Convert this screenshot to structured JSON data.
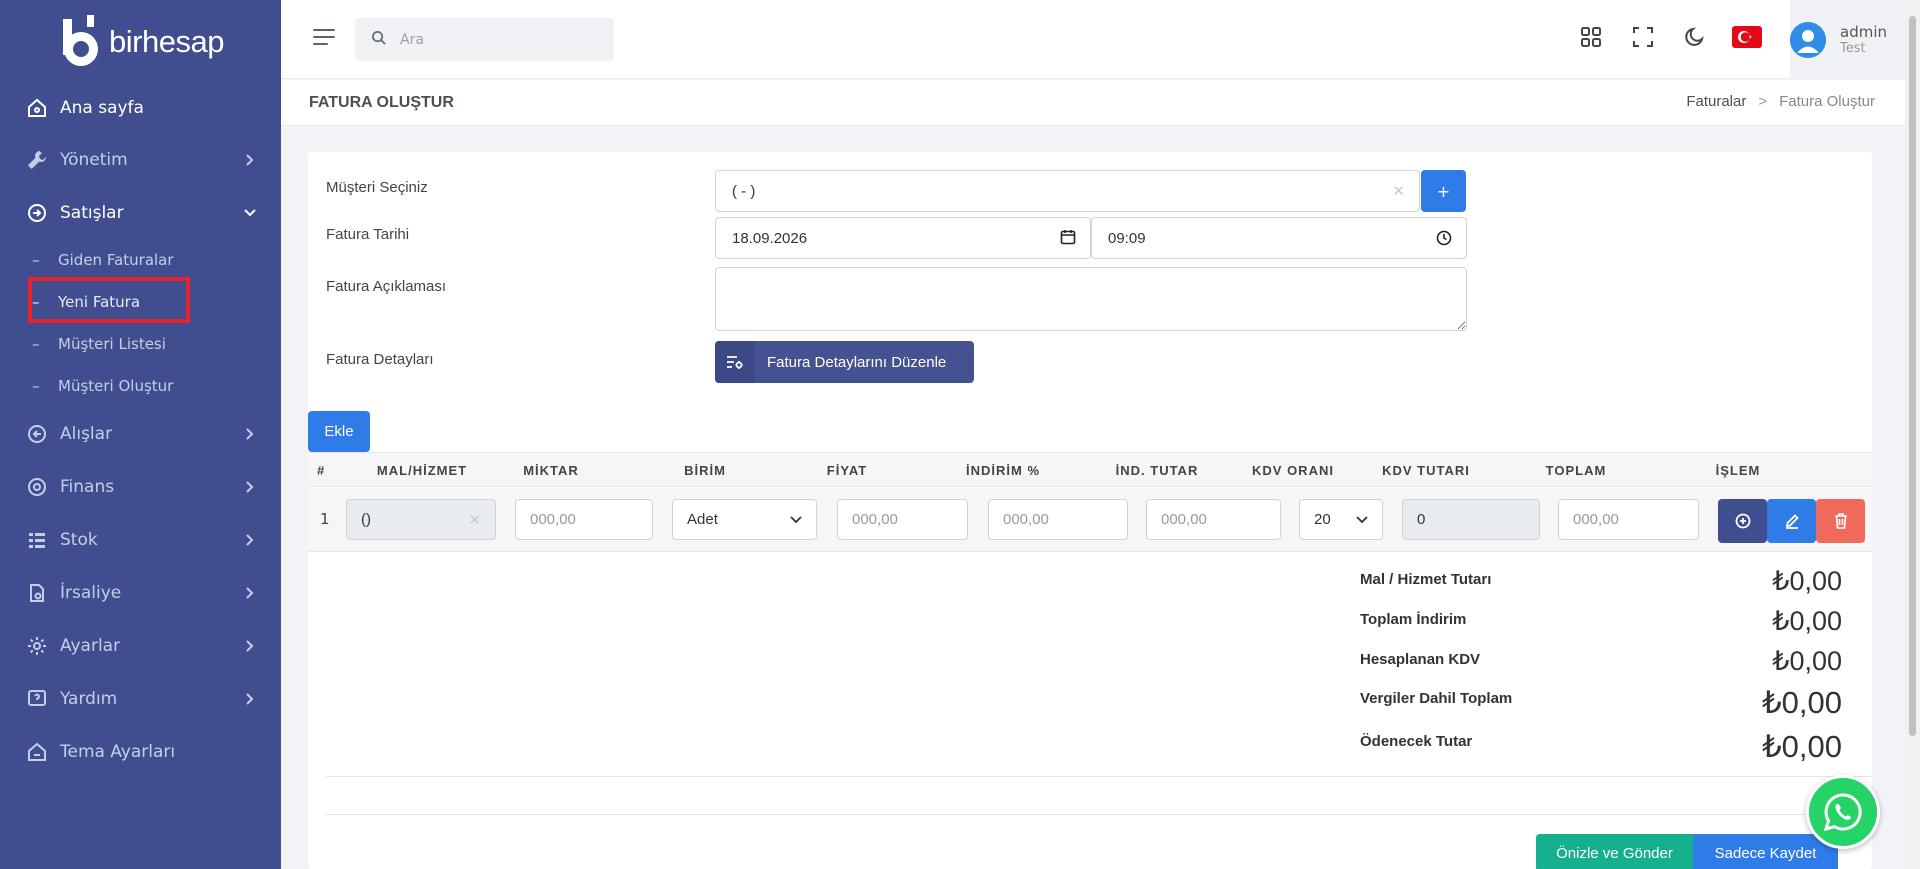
{
  "brand": {
    "name": "birhesap"
  },
  "sidebar": {
    "items": [
      {
        "label": "Ana sayfa",
        "icon": "home-icon",
        "active": true
      },
      {
        "label": "Yönetim",
        "icon": "wrench-icon"
      },
      {
        "label": "Satışlar",
        "icon": "sales-icon",
        "expanded": true,
        "children": [
          "Giden Faturalar",
          "Yeni Fatura",
          "Müşteri Listesi",
          "Müşteri Oluştur"
        ]
      },
      {
        "label": "Alışlar",
        "icon": "purchases-icon"
      },
      {
        "label": "Finans",
        "icon": "finance-icon"
      },
      {
        "label": "Stok",
        "icon": "stock-icon"
      },
      {
        "label": "İrsaliye",
        "icon": "waybill-icon"
      },
      {
        "label": "Ayarlar",
        "icon": "settings-icon"
      },
      {
        "label": "Yardım",
        "icon": "help-icon"
      },
      {
        "label": "Tema Ayarları",
        "icon": "theme-icon"
      }
    ]
  },
  "search": {
    "placeholder": "Ara"
  },
  "user": {
    "name": "admin",
    "role": "Test"
  },
  "page": {
    "title": "FATURA OLUŞTUR"
  },
  "breadcrumb": {
    "parent": "Faturalar",
    "separator": ">",
    "current": "Fatura Oluştur"
  },
  "form": {
    "customer_label": "Müşteri Seçiniz",
    "customer_value": "( - )",
    "add_customer": "+",
    "date_label": "Fatura Tarihi",
    "date_value": "18.09.2026",
    "time_value": "09:09",
    "desc_label": "Fatura Açıklaması",
    "details_label": "Fatura Detayları",
    "details_button": "Fatura Detaylarını Düzenle",
    "add_button": "Ekle"
  },
  "table": {
    "headers": [
      "#",
      "MAL/HİZMET",
      "MİKTAR",
      "BİRİM",
      "FİYAT",
      "İNDİRİM %",
      "İND. TUTAR",
      "KDV ORANI",
      "KDV TUTARI",
      "TOPLAM",
      "İŞLEM"
    ],
    "row": {
      "index": "1",
      "item": "()",
      "quantity_placeholder": "000,00",
      "unit": "Adet",
      "price_placeholder": "000,00",
      "discount_pct_placeholder": "000,00",
      "discount_amount_placeholder": "000,00",
      "vat_rate": "20",
      "vat_amount": "0",
      "total_placeholder": "000,00"
    }
  },
  "totals": [
    {
      "label": "Mal / Hizmet Tutarı",
      "value": "₺0,00"
    },
    {
      "label": "Toplam İndirim",
      "value": "₺0,00"
    },
    {
      "label": "Hesaplanan KDV",
      "value": "₺0,00"
    },
    {
      "label": "Vergiler Dahil Toplam",
      "value": "₺0,00"
    },
    {
      "label": "Ödenecek Tutar",
      "value": "₺0,00"
    }
  ],
  "footer": {
    "preview_send": "Önizle ve Gönder",
    "save_only": "Sadece Kaydet"
  },
  "colors": {
    "sidebar": "#404e8f",
    "primary": "#2f7ce8",
    "success": "#17b08e",
    "danger": "#ef6a5a",
    "dark_btn": "#455291"
  }
}
